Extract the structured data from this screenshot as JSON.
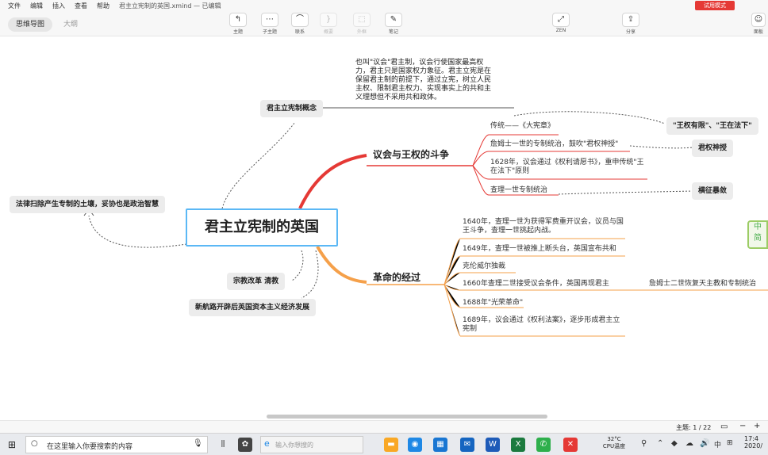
{
  "menubar": {
    "items": [
      "文件",
      "编辑",
      "插入",
      "查看",
      "帮助"
    ],
    "file_title": "君主立宪制的英国.xmind — 已编辑",
    "trial_label": "试用模式"
  },
  "toolbar": {
    "view_tabs": [
      "思维导图",
      "大纲"
    ],
    "tools": [
      {
        "label": "主题",
        "icon": "topic-icon"
      },
      {
        "label": "子主题",
        "icon": "subtopic-icon"
      },
      {
        "label": "联系",
        "icon": "relationship-icon"
      },
      {
        "label": "概要",
        "icon": "summary-icon"
      },
      {
        "label": "外框",
        "icon": "boundary-icon"
      },
      {
        "label": "笔记",
        "icon": "note-icon"
      },
      {
        "label": "ZEN",
        "icon": "zen-icon"
      },
      {
        "label": "分享",
        "icon": "share-icon"
      },
      {
        "label": "面板",
        "icon": "panel-icon"
      }
    ]
  },
  "mindmap": {
    "root": "君主立宪制的英国",
    "concept_node": "君主立宪制概念",
    "concept_note": "也叫\"议会\"君主制，议会行使国家最高权力，君主只是国家权力象征。君主立宪是在保留君主制的前提下，通过立宪，树立人民主权、限制君主权力、实现事实上的共和主义理想但不采用共和政体。",
    "left_nodes": [
      "法律扫除产生专制的土壤，妥协也是政治智慧",
      "宗教改革 清教",
      "新航路开辟后英国资本主义经济发展"
    ],
    "branch1": {
      "title": "议会与王权的斗争",
      "leaves": [
        "传统——《大宪章》",
        "詹姆士一世的专制统治，鼓吹\"君权神授\"",
        "1628年，议会通过《权利请愿书》，重申传统\"王在法下\"原则",
        "查理一世专制统治"
      ]
    },
    "branch2": {
      "title": "革命的经过",
      "leaves": [
        "1640年，查理一世为获得军费重开议会，议员与国王斗争，查理一世挑起内战。",
        "1649年，查理一世被推上断头台，英国宣布共和",
        "克伦威尔独裁",
        "1660年查理二世接受议会条件，英国再现君主",
        "1688年\"光荣革命\"",
        "1689年，议会通过《权利法案》，逐步形成君主立宪制"
      ]
    },
    "right_callouts": [
      "\"王权有限\"、\"王在法下\"",
      "君权神授",
      "横征暴敛"
    ],
    "overflow_text": "詹姆士二世恢复天主教和专制统治"
  },
  "side_widget": "中 简",
  "statusbar": {
    "topic_count": "主题: 1 / 22",
    "zoom_minus": "−",
    "zoom_plus": "+"
  },
  "taskbar": {
    "search_placeholder": "在这里输入你要搜索的内容",
    "edge_search": "输入你想搜的",
    "weather_temp": "32°C",
    "cpu_label": "CPU温度",
    "time": "17:4",
    "date": "2020/"
  }
}
